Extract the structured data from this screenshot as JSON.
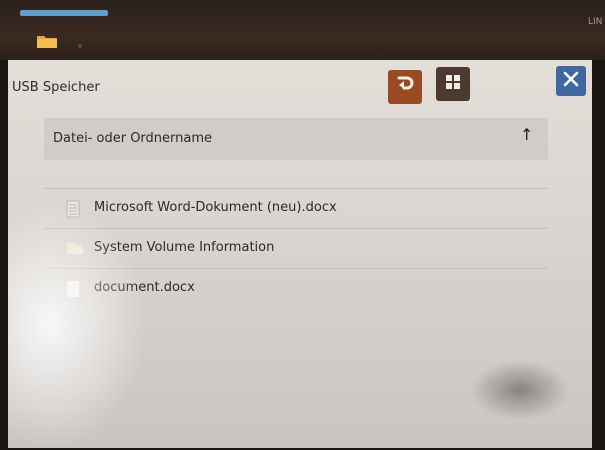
{
  "topbar": {
    "corner_label": "LIN",
    "tab_icon": "folder-icon"
  },
  "toolbar": {
    "title": "USB Speicher",
    "up_icon": "folder-up-icon",
    "grid_icon": "grid-view-icon",
    "close_icon": "close-icon"
  },
  "list_header": {
    "label": "Datei- oder Ordnername",
    "sort_icon": "sort-arrow-up-icon",
    "sort_glyph": "↑"
  },
  "files": [
    {
      "name": "Microsoft Word-Dokument (neu).docx",
      "icon": "document-icon"
    },
    {
      "name": "System Volume Information",
      "icon": "folder-icon"
    },
    {
      "name": "document.docx",
      "icon": "document-icon"
    }
  ],
  "colors": {
    "accent_up": "#9a4a23",
    "close_blue": "#3f68a0",
    "tab_indicator": "#5e9ccc"
  }
}
